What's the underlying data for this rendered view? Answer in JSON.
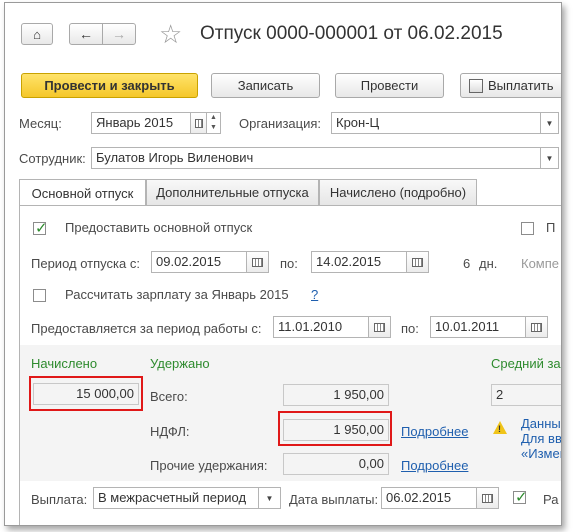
{
  "window": {
    "title": "Отпуск 0000-000001 от 06.02.2015"
  },
  "toolbar": {
    "post_close_label": "Провести и закрыть",
    "save_label": "Записать",
    "post_label": "Провести",
    "pay_label": "Выплатить"
  },
  "header": {
    "month_label": "Месяц:",
    "month_value": "Январь 2015",
    "org_label": "Организация:",
    "org_value": "Крон-Ц",
    "employee_label": "Сотрудник:",
    "employee_value": "Булатов Игорь Виленович"
  },
  "tabs": [
    {
      "label": "Основной отпуск"
    },
    {
      "label": "Дополнительные отпуска"
    },
    {
      "label": "Начислено (подробно)"
    }
  ],
  "main": {
    "grant_main_label": "Предоставить основной отпуск",
    "grant_main_checked": true,
    "right_partial_label_p": "П",
    "period_from_label": "Период отпуска с:",
    "period_from_value": "09.02.2015",
    "period_to_label": "по:",
    "period_to_value": "14.02.2015",
    "days_value": "6",
    "days_label": "дн.",
    "compens_partial": "Компе",
    "recalc_label": "Рассчитать зарплату за Январь 2015",
    "recalc_checked": false,
    "help_label": "?",
    "work_period_label": "Предоставляется за период работы с:",
    "work_from_value": "11.01.2010",
    "work_to_label": "по:",
    "work_to_value": "10.01.2011"
  },
  "totals": {
    "accrued_label": "Начислено",
    "accrued_value": "15 000,00",
    "withheld_label": "Удержано",
    "avg_label_partial": "Средний за",
    "total_label": "Всего:",
    "total_value": "1 950,00",
    "avg_value_partial": "2",
    "ndfl_label": "НДФЛ:",
    "ndfl_value": "1 950,00",
    "ndfl_link": "Подробнее",
    "warning_line1": "Данны",
    "warning_line2": "Для вв",
    "warning_line3": "«Измен",
    "other_label": "Прочие удержания:",
    "other_value": "0,00",
    "other_link": "Подробнее"
  },
  "footer": {
    "payout_label": "Выплата:",
    "payout_value": "В межрасчетный период",
    "pay_date_label": "Дата выплаты:",
    "pay_date_value": "06.02.2015",
    "last_check_checked": true,
    "last_partial": "Ра"
  },
  "colors": {
    "accent_yellow": "#f5c72a",
    "green": "#2e8b2e",
    "link": "#1f5fae",
    "highlight_red": "#e01818"
  }
}
